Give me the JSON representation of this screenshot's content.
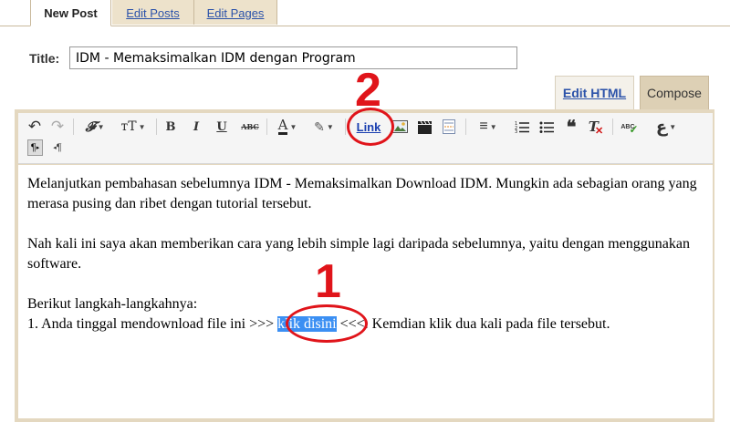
{
  "top_tabs": {
    "new_post": "New Post",
    "edit_posts": "Edit Posts",
    "edit_pages": "Edit Pages"
  },
  "post": {
    "title_label": "Title:",
    "title_value": "IDM - Memaksimalkan IDM dengan Program"
  },
  "mode_tabs": {
    "edit_html": "Edit HTML",
    "compose": "Compose"
  },
  "toolbar": {
    "undo_icon": "↶",
    "redo_icon": "↷",
    "font_icon": "𝓕",
    "font_size_icon": "тT",
    "bold": "B",
    "italic": "I",
    "underline": "U",
    "strikethrough": "ABC",
    "text_color": "A",
    "highlight_icon": "✎",
    "link": "Link",
    "align_icon": "≡",
    "quote_icon": "❝",
    "clear_format": "T",
    "spellcheck": "ABC",
    "transliterate": "ع",
    "ltr_icon": "¶",
    "rtl_icon": "¶"
  },
  "content": {
    "para1": "Melanjutkan pembahasan sebelumnya IDM - Memaksimalkan Download IDM. Mungkin ada sebagian orang yang merasa pusing dan ribet dengan tutorial tersebut.",
    "para2": "Nah kali ini saya akan memberikan cara yang lebih simple lagi daripada sebelumnya, yaitu dengan menggunakan software.",
    "para3_line1": "Berikut langkah-langkahnya:",
    "step1_before": "1. Anda tinggal mendownload file ini >>> ",
    "step1_selected": "klik disini",
    "step1_after": " <<<. Kemdian klik dua kali pada file tersebut."
  },
  "annotations": {
    "marker_1": "1",
    "marker_2": "2"
  },
  "colors": {
    "annotation": "#e0141a",
    "selection": "#3b8ff3",
    "link": "#2b52a9",
    "frame": "#e4d8c0"
  }
}
